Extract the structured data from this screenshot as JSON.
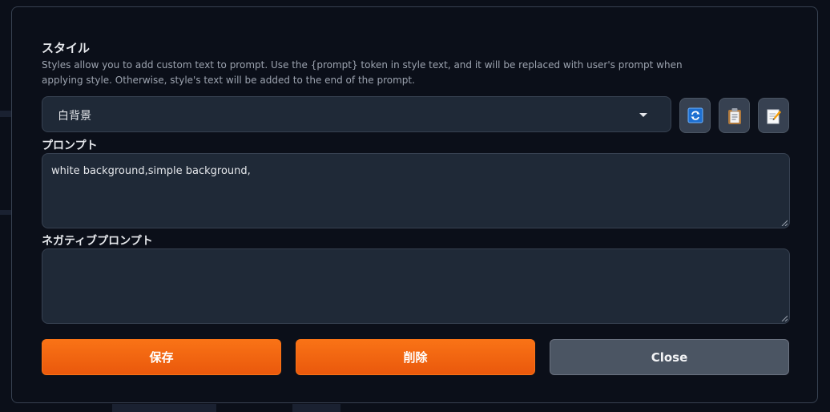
{
  "dialog": {
    "title": "スタイル",
    "description": "Styles allow you to add custom text to prompt. Use the {prompt} token in style text, and it will be replaced with user's prompt when applying style. Otherwise, style's text will be added to the end of the prompt.",
    "style_select": {
      "value": "白背景"
    },
    "tools": [
      {
        "name": "refresh-icon"
      },
      {
        "name": "clipboard-icon"
      },
      {
        "name": "edit-note-icon"
      }
    ],
    "prompt": {
      "label": "プロンプト",
      "value": "white background,simple background,"
    },
    "negative_prompt": {
      "label": "ネガティブプロンプト",
      "value": ""
    },
    "buttons": {
      "save": "保存",
      "delete": "削除",
      "close": "Close"
    }
  },
  "colors": {
    "accent": "#f97316",
    "background": "#0b0f19",
    "panel": "#1f2937",
    "border": "#374151"
  }
}
